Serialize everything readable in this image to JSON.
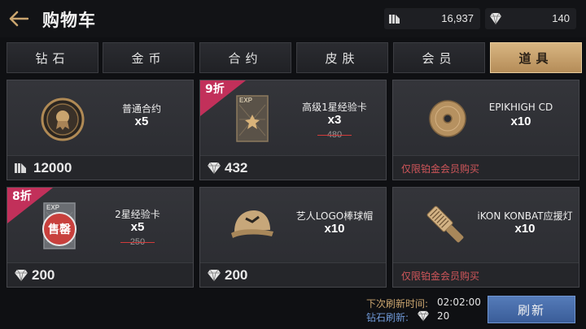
{
  "header": {
    "title": "购物车",
    "coins": "16,937",
    "diamonds": "140"
  },
  "tabs": [
    {
      "label": "钻石",
      "active": false
    },
    {
      "label": "金币",
      "active": false
    },
    {
      "label": "合约",
      "active": false
    },
    {
      "label": "皮肤",
      "active": false
    },
    {
      "label": "会员",
      "active": false
    },
    {
      "label": "道具",
      "active": true
    }
  ],
  "items": [
    {
      "name": "普通合约",
      "qty": "x5",
      "price": "12000",
      "currency": "coin-icon"
    },
    {
      "name": "高级1星经验卡",
      "qty": "x3",
      "original_price": "480",
      "price": "432",
      "currency": "diamond-icon",
      "discount": "9折",
      "image_text": "EXP"
    },
    {
      "name": "EPIKHIGH CD",
      "qty": "x10",
      "vip_note": "仅限铂金会员购买"
    },
    {
      "name": "2星经验卡",
      "qty": "x5",
      "original_price": "250",
      "price": "200",
      "currency": "diamond-icon",
      "discount": "8折",
      "sold_out": "售罄",
      "image_text": "EXP"
    },
    {
      "name": "艺人LOGO棒球帽",
      "qty": "x10",
      "price": "200",
      "currency": "diamond-icon"
    },
    {
      "name": "iKON KONBAT应援灯",
      "qty": "x10",
      "vip_note": "仅限铂金会员购买"
    }
  ],
  "footer": {
    "next_refresh_label": "下次刷新时间:",
    "next_refresh_time": "02:02:00",
    "diamond_refresh_label": "钻石刷新:",
    "diamond_refresh_cost": "20",
    "refresh_button": "刷新"
  },
  "colors": {
    "accent_gold": "#c9a46e",
    "discount_pink": "#c2305a",
    "vip_red": "#d0565a",
    "refresh_blue": "#4a6ea9"
  }
}
